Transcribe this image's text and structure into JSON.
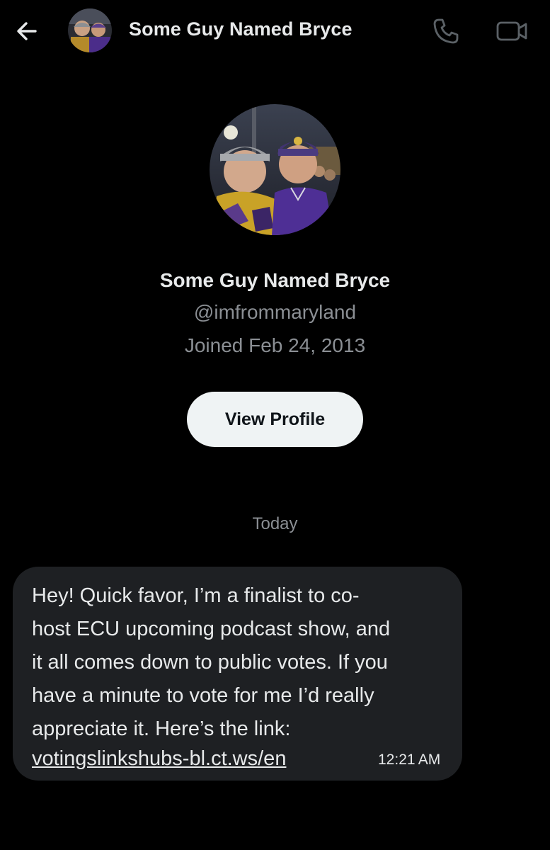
{
  "header": {
    "title": "Some Guy Named Bryce",
    "back_icon": "arrow-left-icon",
    "call_icon": "phone-icon",
    "video_icon": "video-camera-icon"
  },
  "profile": {
    "name": "Some Guy Named Bryce",
    "handle": "@imfrommaryland",
    "joined": "Joined Feb 24, 2013",
    "view_profile_label": "View Profile"
  },
  "conversation": {
    "date_divider": "Today",
    "messages": [
      {
        "text": "Hey! Quick favor, I’m a finalist to co-\nhost ECU upcoming podcast show, and\nit all comes down to public votes. If you\nhave a minute to vote for me I’d really\nappreciate it. Here’s the link:",
        "link": "votingslinkshubs-bl.ct.ws/en",
        "time": "12:21 AM"
      }
    ]
  },
  "colors": {
    "background": "#000000",
    "bubble": "#1e2023",
    "primary_text": "#e7e9ea",
    "secondary_text": "#8b8f94",
    "button_bg": "#eff3f4",
    "button_text": "#0f1419",
    "icon_gray": "#5b6166"
  }
}
